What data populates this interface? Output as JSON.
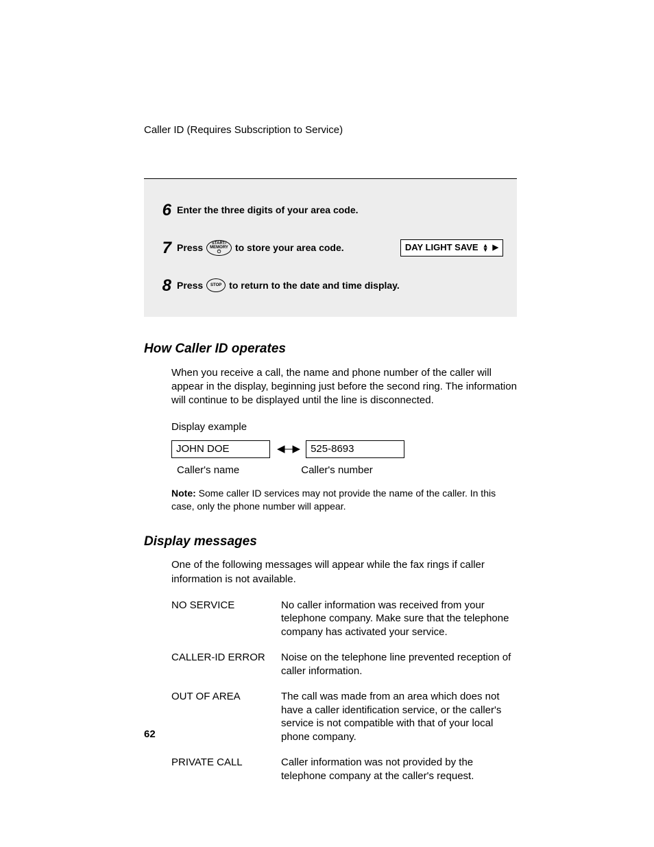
{
  "header": "Caller ID (Requires Subscription to Service)",
  "steps": [
    {
      "num": "6",
      "pre": "Enter the three digits of your area code.",
      "post": ""
    },
    {
      "num": "7",
      "pre": "Press",
      "button_l1": "START/",
      "button_l2": "MEMORY",
      "post": "to store your area code.",
      "lcd": "DAY LIGHT SAVE"
    },
    {
      "num": "8",
      "pre": "Press",
      "button_l1": "STOP",
      "post": "to return to the date and time display."
    }
  ],
  "section1": {
    "heading": "How Caller ID operates",
    "para": "When you receive a call, the name and phone number of the caller will appear in the display, beginning just before the second ring. The information will continue to be displayed until the line is disconnected.",
    "example_label": "Display example",
    "example_name": "JOHN DOE",
    "example_number": "525-8693",
    "caption_name": "Caller's name",
    "caption_number": "Caller's number",
    "note_label": "Note:",
    "note_text": " Some caller ID services may not provide the name of the caller. In this case, only the phone number will appear."
  },
  "section2": {
    "heading": "Display messages",
    "para": "One of the following messages will appear while the fax rings if caller information is not available.",
    "rows": [
      {
        "label": "NO SERVICE",
        "desc": "No caller information was received from your telephone company. Make sure that the telephone company has activated your service."
      },
      {
        "label": "CALLER-ID ERROR",
        "desc": "Noise on the telephone line prevented reception of caller information."
      },
      {
        "label": "OUT OF AREA",
        "desc": "The call was made from an area which does not have a caller identification service, or the caller's service is not compatible with that of your local phone company."
      },
      {
        "label": "PRIVATE CALL",
        "desc": "Caller information was not provided by the telephone company at the caller's request."
      }
    ]
  },
  "page_number": "62"
}
